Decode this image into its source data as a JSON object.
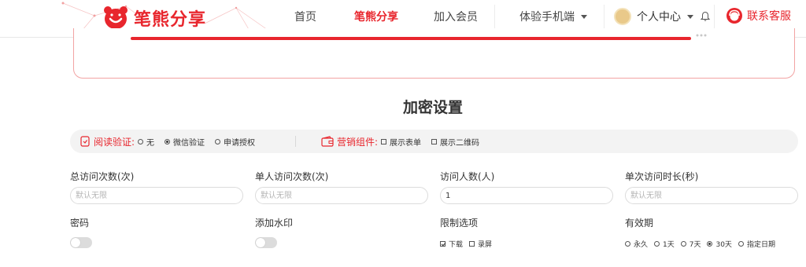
{
  "header": {
    "logo_text": "笔熊分享",
    "nav": [
      {
        "label": "首页"
      },
      {
        "label": "笔熊分享",
        "active": true
      },
      {
        "label": "加入会员"
      },
      {
        "label": "体验手机端"
      }
    ],
    "user_center": "个人中心",
    "service": "联系客服"
  },
  "prev_card": {
    "tag_text": "..."
  },
  "section_title": "加密设置",
  "settings_bar": {
    "read_verify": {
      "label": "阅读验证:",
      "options": [
        {
          "label": "无",
          "selected": false
        },
        {
          "label": "微信验证",
          "selected": true
        },
        {
          "label": "申请授权",
          "selected": false
        }
      ]
    },
    "marketing": {
      "label": "营销组件:",
      "options": [
        {
          "label": "展示表单",
          "checked": false
        },
        {
          "label": "展示二维码",
          "checked": false
        }
      ]
    }
  },
  "fields": {
    "total_visits": {
      "label": "总访问次数(次)",
      "placeholder": "默认无限",
      "value": ""
    },
    "per_user_visits": {
      "label": "单人访问次数(次)",
      "placeholder": "默认无限",
      "value": ""
    },
    "visitors": {
      "label": "访问人数(人)",
      "placeholder": "",
      "value": "1"
    },
    "visit_duration": {
      "label": "单次访问时长(秒)",
      "placeholder": "默认无限",
      "value": ""
    }
  },
  "password": {
    "label": "密码",
    "enabled": false
  },
  "watermark": {
    "label": "添加水印",
    "enabled": false
  },
  "restrictions": {
    "label": "限制选项",
    "options": [
      {
        "label": "下载",
        "checked": true
      },
      {
        "label": "录屏",
        "checked": false
      }
    ]
  },
  "validity": {
    "label": "有效期",
    "options": [
      {
        "label": "永久",
        "selected": false
      },
      {
        "label": "1天",
        "selected": false
      },
      {
        "label": "7天",
        "selected": false
      },
      {
        "label": "30天",
        "selected": true
      },
      {
        "label": "指定日期",
        "selected": false
      }
    ]
  },
  "colors": {
    "brand": "#e8262d",
    "bar_bg": "#f3f3f3"
  }
}
